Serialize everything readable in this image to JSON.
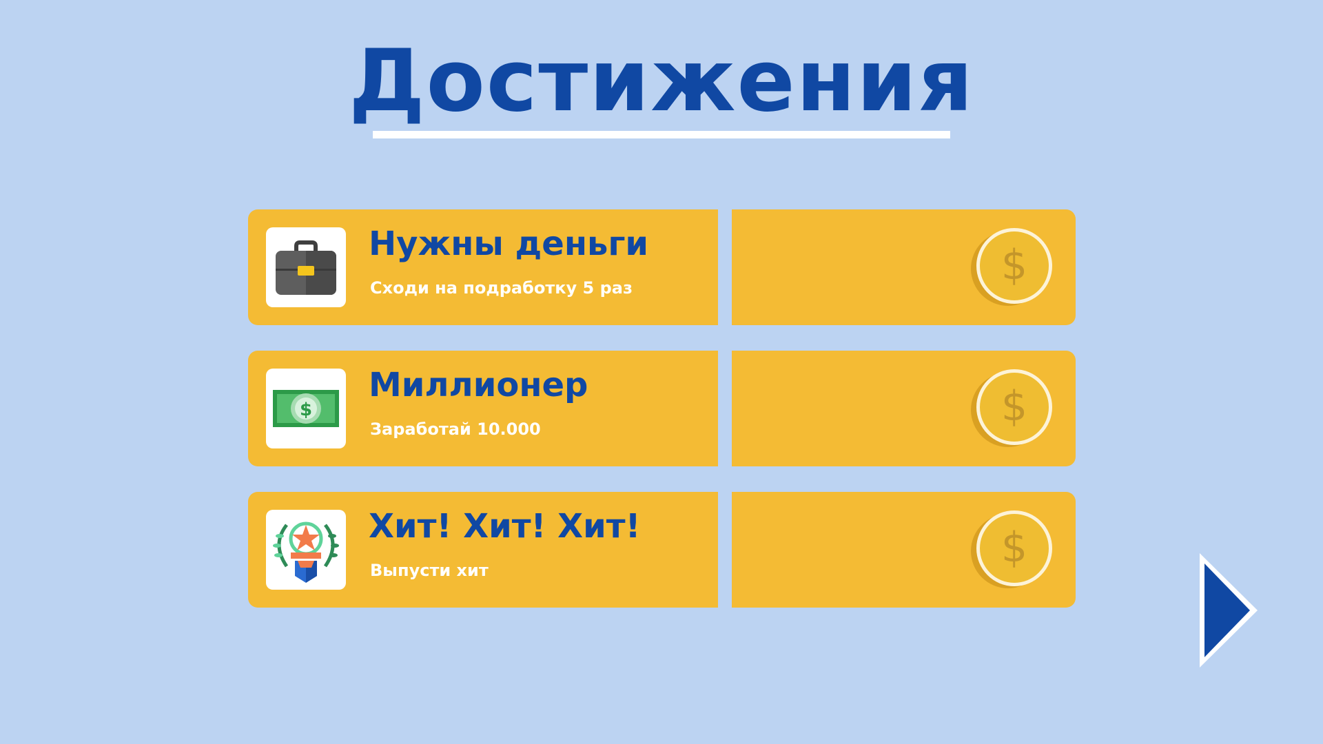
{
  "title": "Достижения",
  "achievements": [
    {
      "title": "Нужны деньги",
      "description": "Сходи на подработку 5 раз",
      "icon": "briefcase-icon",
      "reward_icon": "dollar-coin-icon"
    },
    {
      "title": "Миллионер",
      "description": "Заработай 10.000",
      "icon": "banknote-icon",
      "reward_icon": "dollar-coin-icon"
    },
    {
      "title": "Хит! Хит! Хит!",
      "description": "Выпусти хит",
      "icon": "laurel-star-award-icon",
      "reward_icon": "dollar-coin-icon"
    }
  ],
  "colors": {
    "background": "#bcd3f2",
    "accent": "#1048a3",
    "panel": "#f4bb34",
    "coin": "#efbd32",
    "coin_rim": "#fdf3d8"
  },
  "next_button_icon": "next-arrow-icon"
}
